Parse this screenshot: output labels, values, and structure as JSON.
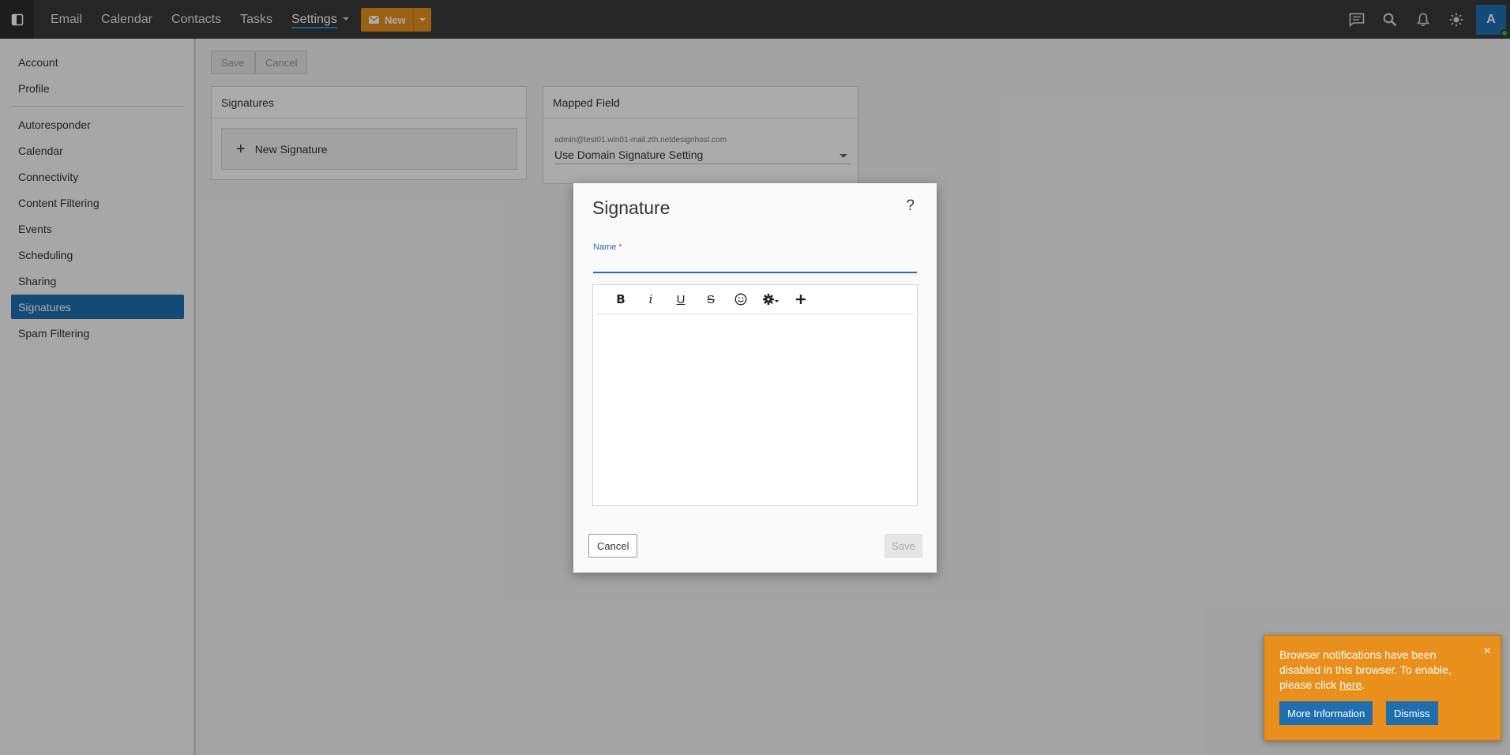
{
  "topbar": {
    "nav": [
      {
        "label": "Email",
        "active": false
      },
      {
        "label": "Calendar",
        "active": false
      },
      {
        "label": "Contacts",
        "active": false
      },
      {
        "label": "Tasks",
        "active": false
      },
      {
        "label": "Settings",
        "active": true
      }
    ],
    "new_label": "New",
    "avatar_letter": "A",
    "accent_color": "#e8901b"
  },
  "leftnav": {
    "items": [
      "Account",
      "Profile",
      "Autoresponder",
      "Calendar",
      "Connectivity",
      "Content Filtering",
      "Events",
      "Scheduling",
      "Sharing",
      "Signatures",
      "Spam Filtering"
    ],
    "active": "Signatures"
  },
  "page": {
    "save_label": "Save",
    "cancel_label": "Cancel",
    "signatures_card": {
      "title": "Signatures",
      "new_signature_label": "New Signature"
    },
    "mapped_field_card": {
      "title": "Mapped Field",
      "account_label": "admin@test01.win01-mail.zth.netdesignhost.com",
      "selected_value": "Use Domain Signature Setting"
    }
  },
  "dialog": {
    "title": "Signature",
    "help_label": "?",
    "name_label": "Name",
    "name_required_mark": "*",
    "name_value": "",
    "cancel_label": "Cancel",
    "save_label": "Save"
  },
  "toast": {
    "message": "Browser notifications have been disabled in this browser. To enable, please click ",
    "link_label": "here",
    "message_end": ".",
    "more_info_label": "More Information",
    "dismiss_label": "Dismiss",
    "close_label": "×"
  }
}
